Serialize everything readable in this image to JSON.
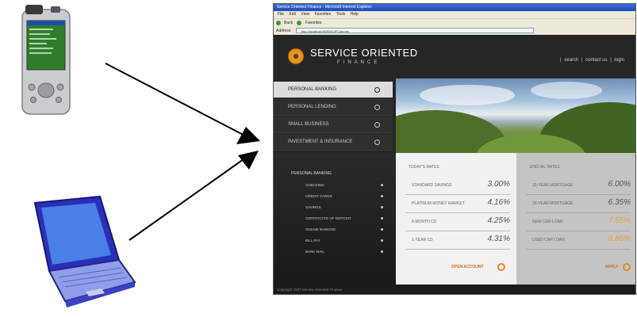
{
  "browser": {
    "title": "Service Oriented Finance - Microsoft Internet Explorer",
    "menu": [
      "File",
      "Edit",
      "View",
      "Favorites",
      "Tools",
      "Help"
    ],
    "toolbar": [
      "Back",
      "Favorites"
    ],
    "address_label": "Address",
    "address_value": "http://localhost:9080/SOFCatcom/"
  },
  "site": {
    "brand_main": "SERVICE ORIENTED",
    "brand_sub": "FINANCE",
    "top_links": [
      "search",
      "contact us",
      "login"
    ],
    "top_sep": "|",
    "nav_items": [
      "PERSONAL BANKING",
      "PERSONAL LENDING",
      "SMALL BUSINESS",
      "INVESTMENT & INSURANCE"
    ],
    "sub_heading": "PERSONAL BANKING",
    "sub_items": [
      "CHECKING",
      "CREDIT CARDS",
      "SAVINGS",
      "CERTIFICATE OF DEPOSIT",
      "ONLINE BANKING",
      "BILL PAY",
      "BANK MAIL"
    ],
    "todays_rates": {
      "heading": "TODAY'S RATES",
      "rows": [
        {
          "label": "STANDARD SAVINGS",
          "value": "3.00%"
        },
        {
          "label": "PLATINUM MONEY MARKET",
          "value": "4.16%"
        },
        {
          "label": "6-MONTH CD",
          "value": "4.25%"
        },
        {
          "label": "1-YEAR CD",
          "value": "4.31%"
        }
      ],
      "cta": "OPEN ACCOUNT"
    },
    "special_rates": {
      "heading": "SPECIAL RATES",
      "rows": [
        {
          "label": "15-YEAR MORTGAGE",
          "value": "6.00%"
        },
        {
          "label": "30-YEAR MORTGAGE",
          "value": "6.35%"
        },
        {
          "label": "NEW CAR LOAN",
          "value": "7.55%"
        },
        {
          "label": "USED CAR LOAN",
          "value": "8.85%"
        }
      ],
      "cta": "APPLY"
    },
    "footer": "Copyright 2007 Service Oriented Finance"
  },
  "colors": {
    "accent": "#e08a1e",
    "highlight_rate": "#e8a23c",
    "site_bg": "#262626"
  },
  "devices": [
    "pda-icon",
    "laptop-icon"
  ]
}
